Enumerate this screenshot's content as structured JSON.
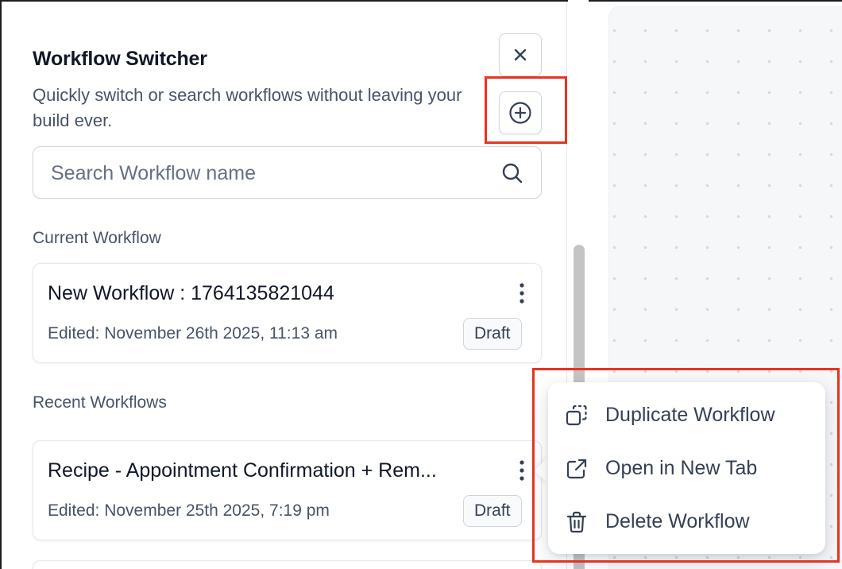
{
  "panel": {
    "title": "Workflow Switcher",
    "subtitle": "Quickly switch or search workflows without leaving your build ever."
  },
  "search": {
    "placeholder": "Search Workflow name"
  },
  "current": {
    "label": "Current Workflow",
    "workflow": {
      "name": "New Workflow : 1764135821044",
      "edited": "Edited: November 26th 2025, 11:13 am",
      "status": "Draft"
    }
  },
  "recent": {
    "label": "Recent Workflows",
    "workflows": [
      {
        "name": "Recipe - Appointment Confirmation + Rem...",
        "edited": "Edited: November 25th 2025, 7:19 pm",
        "status": "Draft"
      }
    ]
  },
  "context_menu": {
    "items": [
      {
        "label": "Duplicate Workflow",
        "icon": "duplicate-icon"
      },
      {
        "label": "Open in New Tab",
        "icon": "external-link-icon"
      },
      {
        "label": "Delete Workflow",
        "icon": "trash-icon"
      }
    ]
  },
  "colors": {
    "highlight": "#e8331f",
    "text_primary": "#101828",
    "text_secondary": "#475467",
    "border": "#d0d5dd"
  }
}
